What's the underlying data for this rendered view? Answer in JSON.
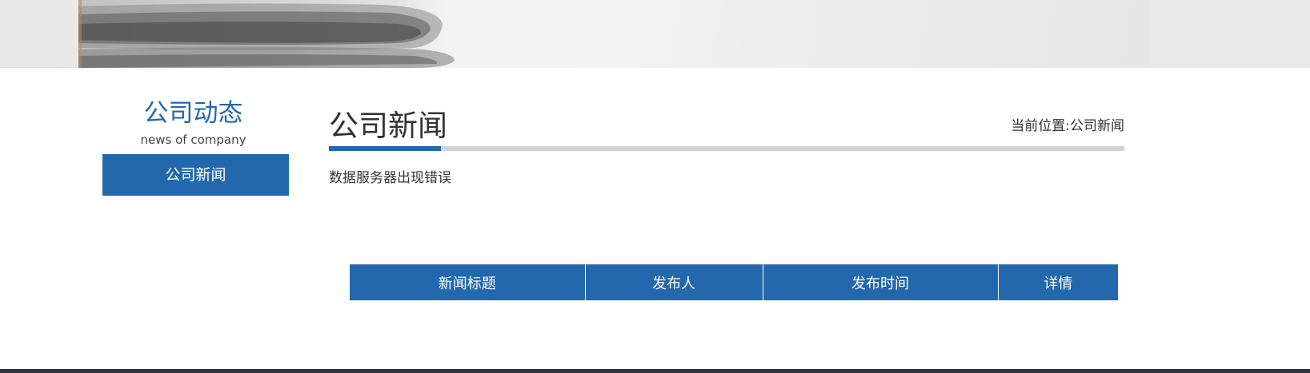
{
  "sidebar": {
    "title": "公司动态",
    "subtitle": "news of company",
    "items": [
      {
        "label": "公司新闻"
      }
    ]
  },
  "main": {
    "title": "公司新闻",
    "breadcrumb": {
      "prefix": "当前位置:",
      "current": "公司新闻"
    },
    "error_message": "数据服务器出现错误"
  },
  "table": {
    "headers": [
      "新闻标题",
      "发布人",
      "发布时间",
      "详情"
    ]
  },
  "colors": {
    "accent": "#2368ad",
    "text": "#333333",
    "rule": "#d3d3d3",
    "footer": "#2b3340"
  }
}
